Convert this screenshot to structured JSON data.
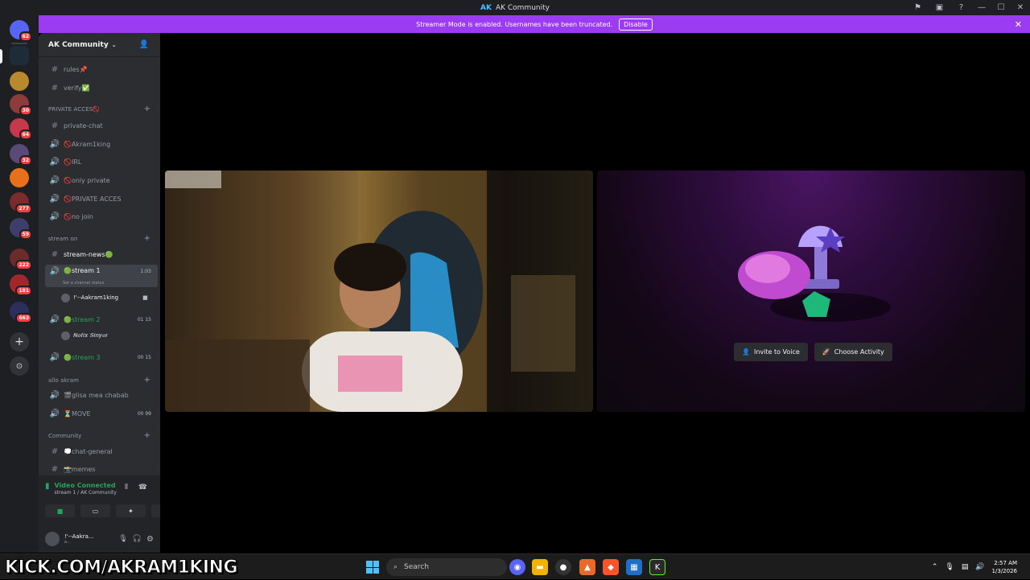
{
  "window": {
    "title": "AK Community"
  },
  "notice": {
    "text": "Streamer Mode is enabled. Usernames have been truncated.",
    "disable_label": "Disable"
  },
  "servers": {
    "badges": [
      "62",
      "30",
      "64",
      "32",
      "277",
      "59",
      "222",
      "181",
      "663"
    ]
  },
  "guild": {
    "name": "AK Community"
  },
  "channels": {
    "top": [
      {
        "name": "rules📌",
        "type": "text"
      },
      {
        "name": "verify✅",
        "type": "text"
      }
    ],
    "private_category": "PRIVATE ACCES🚫",
    "private": [
      {
        "name": "private-chat",
        "type": "text"
      },
      {
        "name": "🚫Akram1king",
        "type": "voice"
      },
      {
        "name": "🚫IRL",
        "type": "voice"
      },
      {
        "name": "🚫only private",
        "type": "voice"
      },
      {
        "name": "🚫PRIVATE ACCES",
        "type": "voice"
      },
      {
        "name": "🚫no join",
        "type": "voice"
      }
    ],
    "stream_category": "stream on",
    "stream_news": "stream-news🟢",
    "stream1": {
      "name": "🟢stream 1",
      "time": "1:03",
      "status": "Set a channel status",
      "user": "!'--Aakram1king"
    },
    "stream2": {
      "name": "🟢stream 2",
      "tag": "01  15",
      "user": "𝑵𝒐𝒇𝒊𝒙 𝑺𝒊𝒏𝒚𝒐𝒓"
    },
    "stream3": {
      "name": "🟢stream 3",
      "tag": "00  15"
    },
    "allo_category": "allo akram",
    "allo": [
      {
        "name": "🎬glisa mea chabab",
        "tag": ""
      },
      {
        "name": "⏳MOVE",
        "tag": "00  99"
      }
    ],
    "community_category": "Community",
    "community": [
      {
        "name": "💭chat-general",
        "type": "text"
      },
      {
        "name": "📸memes",
        "type": "text"
      }
    ]
  },
  "voice_panel": {
    "status": "Video Connected",
    "location": "stream 1 / AK Community",
    "username": "!'--Aakra...",
    "sub": "a..."
  },
  "activity": {
    "invite_label": "Invite to Voice",
    "choose_label": "Choose Activity"
  },
  "taskbar": {
    "overlay": "KICK.COM/AKRAM1KING",
    "search_placeholder": "Search",
    "time": "2:57 AM",
    "date": "1/3/2026"
  }
}
